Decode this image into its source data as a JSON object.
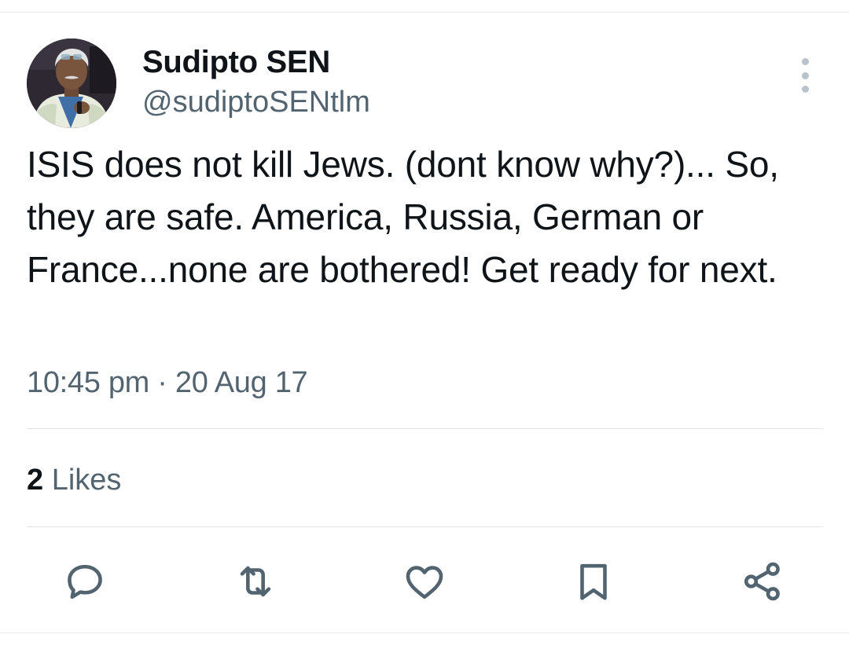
{
  "tweet": {
    "author": {
      "display_name": "Sudipto SEN",
      "handle": "@sudiptoSENtlm"
    },
    "text": "ISIS does not kill Jews. (dont know why?)... So, they are safe. America, Russia, German or France...none are bothered! Get ready for next.",
    "timestamp": "10:45 pm · 20 Aug 17",
    "likes": {
      "count": "2",
      "label": "Likes"
    }
  },
  "actions": [
    {
      "name": "reply",
      "icon": "reply-icon"
    },
    {
      "name": "retweet",
      "icon": "retweet-icon"
    },
    {
      "name": "like",
      "icon": "heart-icon"
    },
    {
      "name": "bookmark",
      "icon": "bookmark-icon"
    },
    {
      "name": "share",
      "icon": "share-icon"
    }
  ],
  "colors": {
    "text_primary": "#0f1419",
    "text_secondary": "#536471",
    "divider": "#e1e5e8",
    "more_dots": "#b9c3cb"
  }
}
